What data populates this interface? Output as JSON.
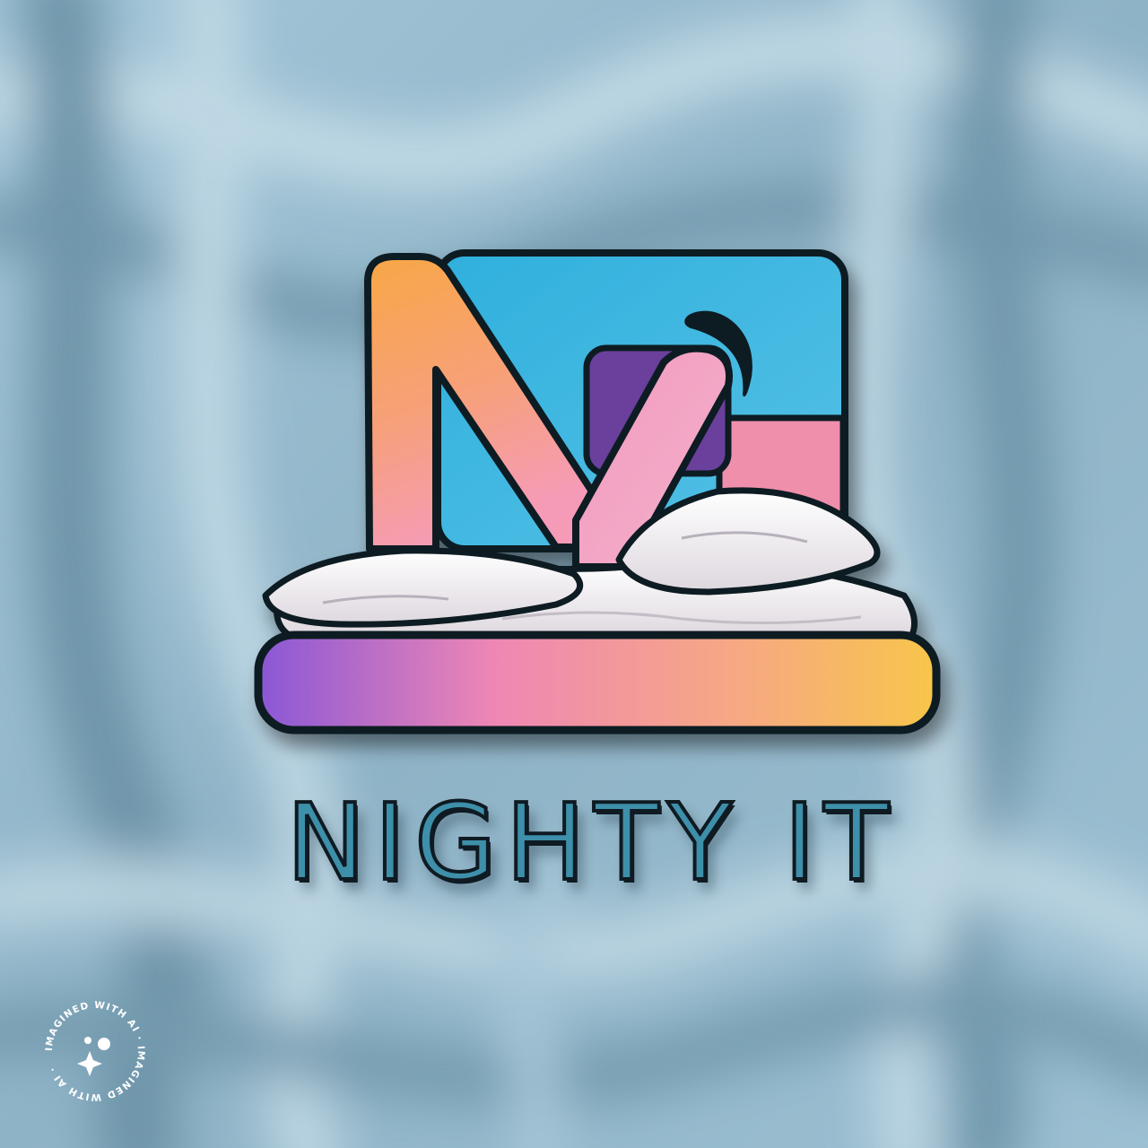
{
  "brand": {
    "name": "NIGHTY IT"
  },
  "watermark": {
    "text": "IMAGINED WITH AI · IMAGINED WITH AI · ",
    "icon": "sparkle-icon"
  },
  "colors": {
    "background_fabric": "#8fb3c6",
    "letter_gradient_start": "#f7a24a",
    "letter_gradient_end": "#f6a3c4",
    "panel_blue": "#44b7e0",
    "panel_pink": "#ef8fac",
    "panel_purple": "#6a3f9c",
    "base_gradient_start": "#8a57d6",
    "base_gradient_mid": "#f08ab0",
    "base_gradient_end": "#f8c34a",
    "pillow_white": "#f4f1f4",
    "outline": "#0f1a22",
    "text_teal": "#3e8fa9"
  }
}
